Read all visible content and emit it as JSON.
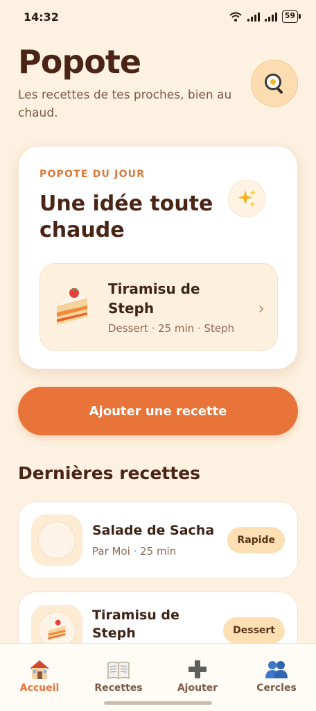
{
  "status_bar": {
    "time": "14:32",
    "battery": "59",
    "icons": [
      "wifi-icon",
      "signal-icon",
      "signal-icon",
      "battery-icon"
    ]
  },
  "header": {
    "app_title": "Popote",
    "tagline": "Les recettes de tes proches, bien au chaud.",
    "profile_icon": "frying-pan-egg-icon"
  },
  "daily": {
    "eyebrow": "POPOTE DU JOUR",
    "title": "Une idée toute chaude",
    "sparkle_icon": "sparkles-icon",
    "recipe": {
      "name": "Tiramisu de Steph",
      "meta": "Dessert · 25 min · Steph",
      "icon": "cake-slice-icon"
    }
  },
  "add_button_label": "Ajouter une recette",
  "recent": {
    "title": "Dernières recettes",
    "items": [
      {
        "name": "Salade de Sacha",
        "meta": "Par Moi · 25 min",
        "tag": "Rapide",
        "icon": "empty-plate-icon"
      },
      {
        "name": "Tiramisu de Steph",
        "meta": "",
        "tag": "Dessert",
        "icon": "cake-slice-icon"
      }
    ]
  },
  "tabbar": {
    "tabs": [
      {
        "label": "Accueil",
        "icon": "house-icon",
        "active": true
      },
      {
        "label": "Recettes",
        "icon": "book-icon",
        "active": false
      },
      {
        "label": "Ajouter",
        "icon": "plus-icon",
        "active": false
      },
      {
        "label": "Cercles",
        "icon": "people-icon",
        "active": false
      }
    ]
  },
  "colors": {
    "background": "#FDF1E1",
    "accent": "#E8743A",
    "title_text": "#4A2414",
    "tag_background": "#FCE0B4"
  }
}
